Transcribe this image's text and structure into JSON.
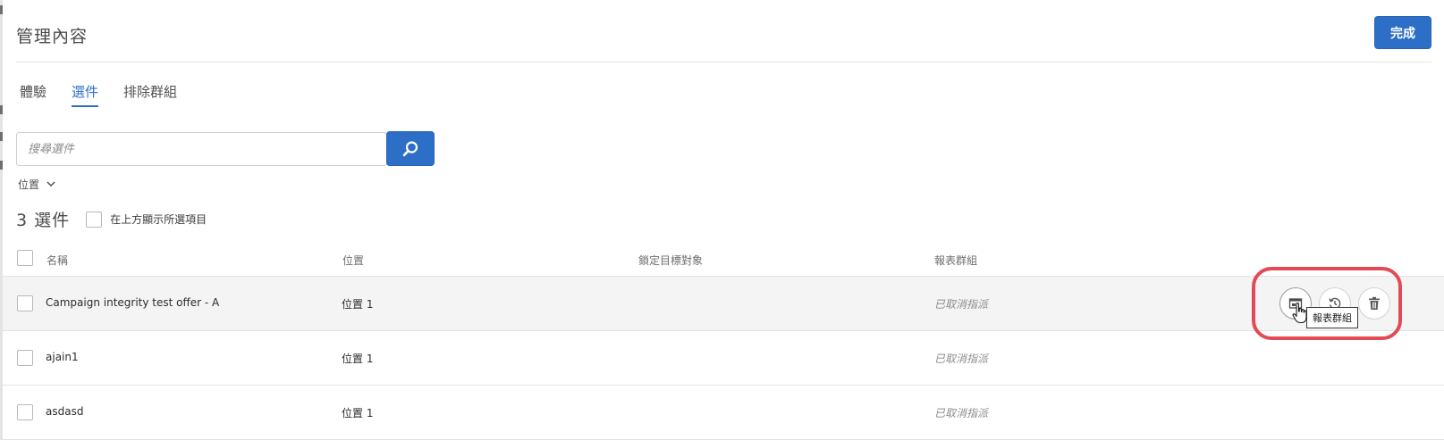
{
  "header": {
    "title": "管理內容",
    "done_label": "完成"
  },
  "tabs": [
    {
      "label": "體驗",
      "active": false
    },
    {
      "label": "選件",
      "active": true
    },
    {
      "label": "排除群組",
      "active": false
    }
  ],
  "search": {
    "placeholder": "搜尋選件",
    "value": "",
    "button_icon": "search-icon"
  },
  "filter": {
    "label": "位置",
    "icon": "chevron-down-icon"
  },
  "summary": {
    "count_label": "3 選件",
    "show_selected_label": "在上方顯示所選項目"
  },
  "table": {
    "columns": [
      "名稱",
      "位置",
      "鎖定目標對象",
      "報表群組"
    ],
    "rows": [
      {
        "name": "Campaign integrity test offer - A",
        "location": "位置 1",
        "targeting": "",
        "report_group": "已取消指派"
      },
      {
        "name": "ajain1",
        "location": "位置 1",
        "targeting": "",
        "report_group": "已取消指派"
      },
      {
        "name": "asdasd",
        "location": "位置 1",
        "targeting": "",
        "report_group": "已取消指派"
      }
    ]
  },
  "row_actions": [
    {
      "icon": "report-group-icon"
    },
    {
      "icon": "history-icon"
    },
    {
      "icon": "trash-icon"
    }
  ],
  "tooltip": {
    "text": "報表群組"
  },
  "colors": {
    "accent": "#2d6fc6",
    "highlight": "#e24b55"
  }
}
